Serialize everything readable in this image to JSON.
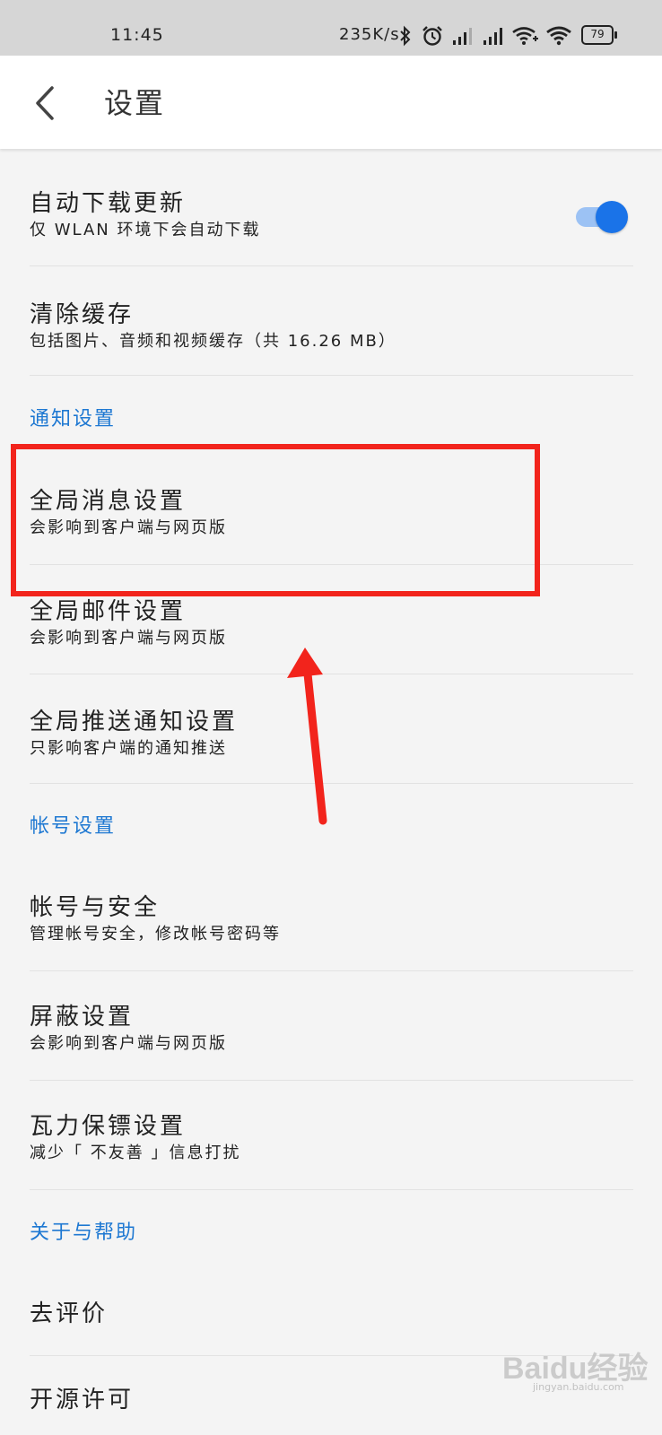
{
  "status_bar": {
    "time": "11:45",
    "net_speed": "235K/s",
    "battery": "79"
  },
  "header": {
    "title": "设置"
  },
  "rows": {
    "auto_download": {
      "title": "自动下载更新",
      "subtitle": "仅 WLAN 环境下会自动下载",
      "toggle_on": true
    },
    "clear_cache": {
      "title": "清除缓存",
      "subtitle": "包括图片、音频和视频缓存（共 16.26 MB）"
    },
    "global_message": {
      "title": "全局消息设置",
      "subtitle": "会影响到客户端与网页版"
    },
    "global_mail": {
      "title": "全局邮件设置",
      "subtitle": "会影响到客户端与网页版"
    },
    "global_push": {
      "title": "全局推送通知设置",
      "subtitle": "只影响客户端的通知推送"
    },
    "account_security": {
      "title": "帐号与安全",
      "subtitle": "管理帐号安全，修改帐号密码等"
    },
    "block_settings": {
      "title": "屏蔽设置",
      "subtitle": "会影响到客户端与网页版"
    },
    "bodyguard": {
      "title": "瓦力保镖设置",
      "subtitle": "减少「 不友善 」信息打扰"
    },
    "rate": {
      "title": "去评价"
    },
    "open_source": {
      "title": "开源许可"
    }
  },
  "sections": {
    "notification": "通知设置",
    "account": "帐号设置",
    "about": "关于与帮助"
  },
  "watermark": {
    "brand": "Baidu经验",
    "url": "jingyan.baidu.com"
  },
  "colors": {
    "accent": "#1a73e8",
    "section_header": "#1e78d2",
    "annotation_red": "#f2241c"
  }
}
